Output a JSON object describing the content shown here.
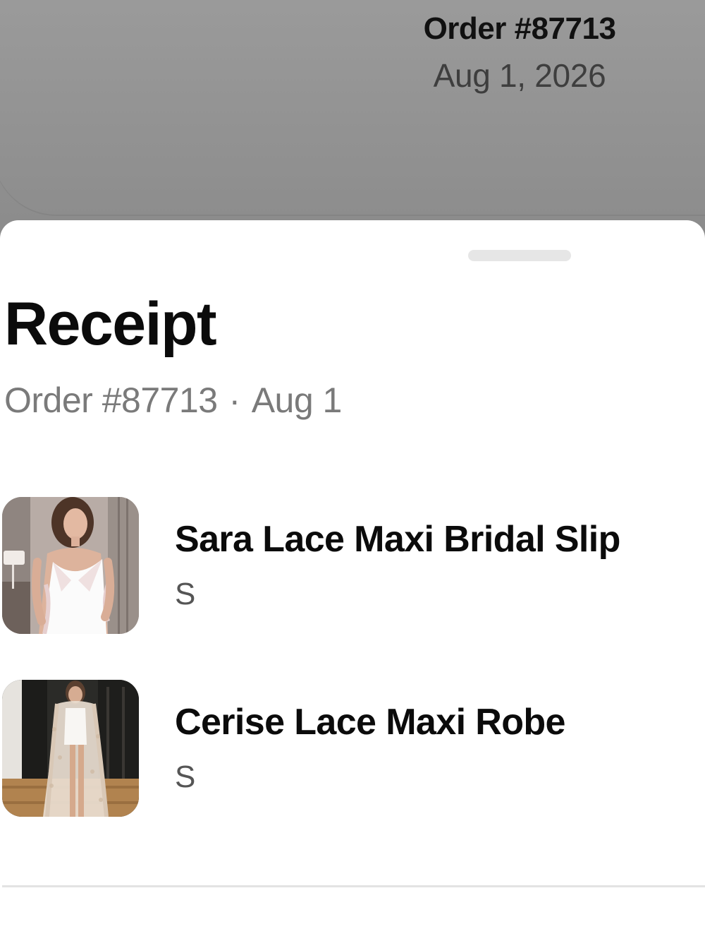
{
  "background_page": {
    "order_title": "Order #87713",
    "order_date": "Aug 1, 2026"
  },
  "sheet": {
    "title": "Receipt",
    "order_label": "Order #87713",
    "separator": "·",
    "order_date_short": "Aug 1"
  },
  "items": [
    {
      "name": "Sara Lace Maxi Bridal Slip",
      "size": "S",
      "image": "product-photo-white-satin-slip"
    },
    {
      "name": "Cerise Lace Maxi Robe",
      "size": "S",
      "image": "product-photo-lace-robe"
    }
  ],
  "colors": {
    "sheet_background": "#ffffff",
    "dim_overlay": "#8f8f8f",
    "primary_text": "#0b0b0b",
    "secondary_text": "#7a7a7a"
  }
}
